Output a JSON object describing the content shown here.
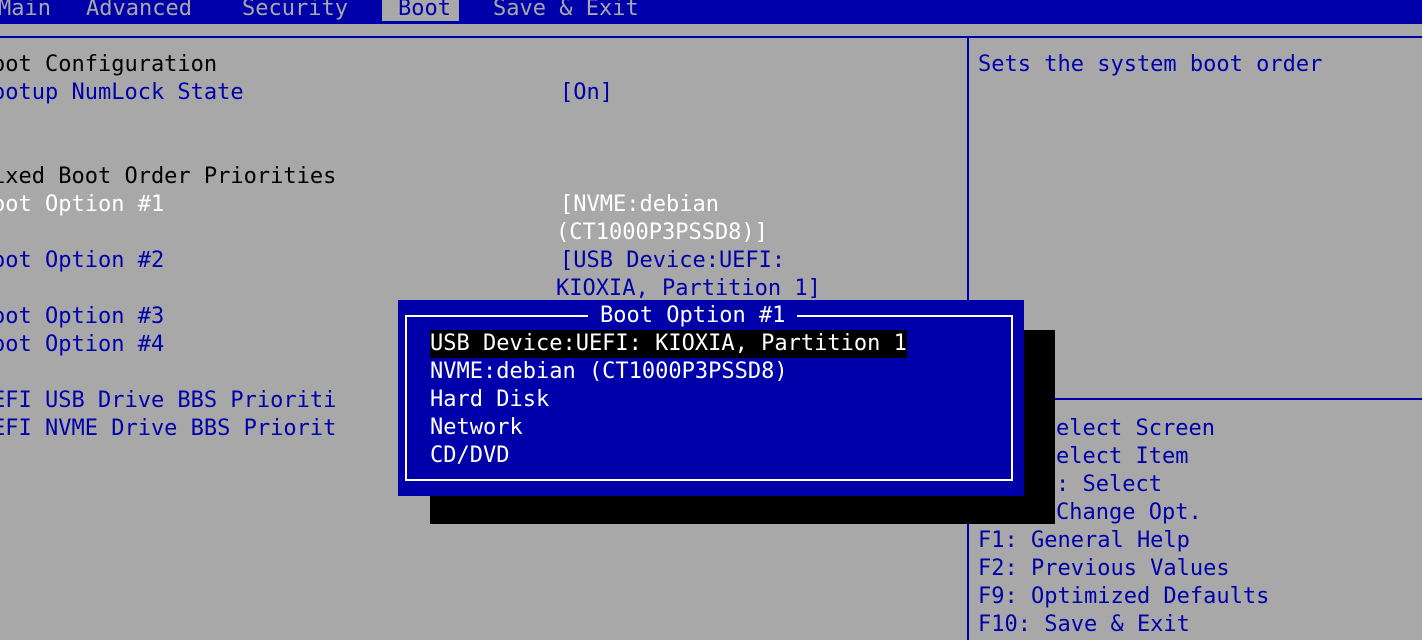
{
  "menu": {
    "tabs": [
      "Main",
      "Advanced",
      "Security",
      "Boot",
      "Save & Exit"
    ],
    "active": "Boot"
  },
  "settings": {
    "boot_configuration_heading": "oot Configuration",
    "numlock_label": "ootup NumLock State",
    "numlock_value": "[On]",
    "fixed_priorities_heading": "ixed Boot Order Priorities",
    "boot_option_1_label": "oot Option #1",
    "boot_option_1_value_line1": "[NVME:debian",
    "boot_option_1_value_line2": "(CT1000P3PSSD8)]",
    "boot_option_2_label": "oot Option #2",
    "boot_option_2_value_line1": "[USB Device:UEFI:",
    "boot_option_2_value_line2": "KIOXIA, Partition 1]",
    "boot_option_3_label": "oot Option #3",
    "boot_option_4_label": "oot Option #4",
    "usb_bbs_label": "EFI USB Drive BBS Prioriti",
    "nvme_bbs_label": "EFI NVME Drive BBS Priorit"
  },
  "help": {
    "description": "Sets the system boot order",
    "keys": [
      "elect Screen",
      "elect Item",
      ": Select",
      "Change Opt.",
      "F1: General Help",
      "F2: Previous Values",
      "F9: Optimized Defaults",
      "F10: Save & Exit"
    ]
  },
  "popup": {
    "title": "Boot Option #1",
    "options": [
      "USB Device:UEFI: KIOXIA, Partition 1",
      "NVME:debian (CT1000P3PSSD8)",
      "Hard Disk",
      "Network",
      "CD/DVD"
    ],
    "selected_index": 0
  },
  "colors": {
    "background": "#a8a8a8",
    "bios_blue": "#0000aa",
    "highlight_text": "#ffffff",
    "selection_bg": "#000000"
  }
}
